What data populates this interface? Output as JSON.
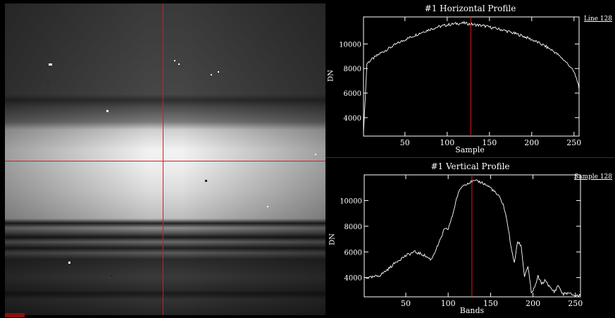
{
  "image_view": {
    "cursor_note": "",
    "corner_tag": "",
    "crosshair_color": "#e01818"
  },
  "horizontal_profile": {
    "title": "#1 Horizontal Profile",
    "readout": "Line 128",
    "xlabel": "Sample",
    "ylabel": "DN"
  },
  "vertical_profile": {
    "title": "#1 Vertical Profile",
    "readout": "Sample 128",
    "xlabel": "Bands",
    "ylabel": "DN"
  },
  "chart_data": [
    {
      "type": "line",
      "title": "#1 Horizontal Profile",
      "xlabel": "Sample",
      "ylabel": "DN",
      "xlim": [
        1,
        256
      ],
      "ylim": [
        2500,
        12200
      ],
      "xticks": [
        50,
        100,
        150,
        200,
        250
      ],
      "yticks": [
        4000,
        6000,
        8000,
        10000
      ],
      "marker_x": 128,
      "x": [
        1,
        5,
        10,
        20,
        30,
        40,
        50,
        60,
        70,
        80,
        90,
        100,
        110,
        120,
        128,
        135,
        145,
        155,
        165,
        175,
        185,
        195,
        205,
        215,
        225,
        235,
        245,
        250,
        254,
        256
      ],
      "series": [
        {
          "values": [
            2700,
            8400,
            8700,
            9200,
            9600,
            10000,
            10350,
            10650,
            10950,
            11200,
            11400,
            11550,
            11650,
            11700,
            11600,
            11550,
            11450,
            11300,
            11150,
            10950,
            10750,
            10500,
            10200,
            9850,
            9450,
            8900,
            8200,
            7700,
            7000,
            6300
          ]
        }
      ]
    },
    {
      "type": "line",
      "title": "#1 Vertical Profile",
      "xlabel": "Bands",
      "ylabel": "DN",
      "xlim": [
        1,
        256
      ],
      "ylim": [
        2500,
        12000
      ],
      "xticks": [
        50,
        100,
        150,
        200,
        250
      ],
      "yticks": [
        4000,
        6000,
        8000,
        10000
      ],
      "marker_x": 128,
      "x": [
        1,
        10,
        20,
        30,
        40,
        50,
        60,
        70,
        80,
        90,
        95,
        100,
        105,
        110,
        115,
        120,
        125,
        130,
        135,
        140,
        150,
        160,
        165,
        170,
        175,
        178,
        182,
        186,
        190,
        194,
        198,
        202,
        206,
        210,
        215,
        220,
        225,
        230,
        235,
        240,
        250,
        256
      ],
      "series": [
        {
          "values": [
            4000,
            4000,
            4200,
            4700,
            5300,
            5700,
            6000,
            5800,
            5400,
            6800,
            7700,
            7800,
            8800,
            10200,
            11000,
            11300,
            11400,
            11500,
            11500,
            11400,
            11000,
            10300,
            9700,
            8200,
            6000,
            5200,
            6800,
            6500,
            4100,
            4900,
            2800,
            3200,
            4100,
            3500,
            3800,
            3200,
            2900,
            3400,
            2700,
            2800,
            2600,
            2600
          ]
        }
      ]
    }
  ]
}
